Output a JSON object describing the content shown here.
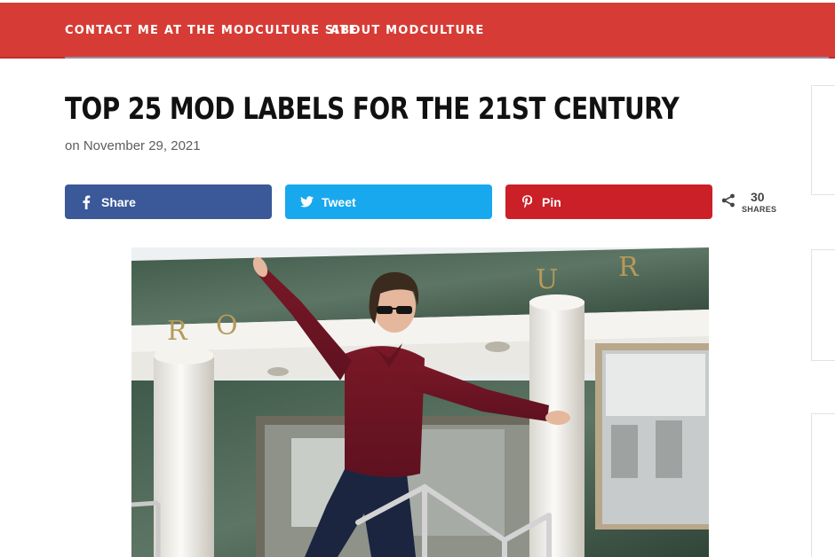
{
  "nav": {
    "links": [
      {
        "label": "CONTACT ME AT THE MODCULTURE SITE"
      },
      {
        "label": "ABOUT MODCULTURE"
      }
    ]
  },
  "article": {
    "title": "TOP 25 MOD LABELS FOR THE 21ST CENTURY",
    "date": "on November 29, 2021"
  },
  "share": {
    "buttons": [
      {
        "label": "Share",
        "icon": "facebook-icon",
        "color": "#3b5998"
      },
      {
        "label": "Tweet",
        "icon": "twitter-icon",
        "color": "#18a8ee"
      },
      {
        "label": "Pin",
        "icon": "pinterest-icon",
        "color": "#cb2027"
      }
    ],
    "count": "30",
    "count_label": "SHARES"
  },
  "hero": {
    "sign_letters": [
      "R",
      "O",
      "U",
      "R"
    ],
    "accent": "#d63c35"
  }
}
